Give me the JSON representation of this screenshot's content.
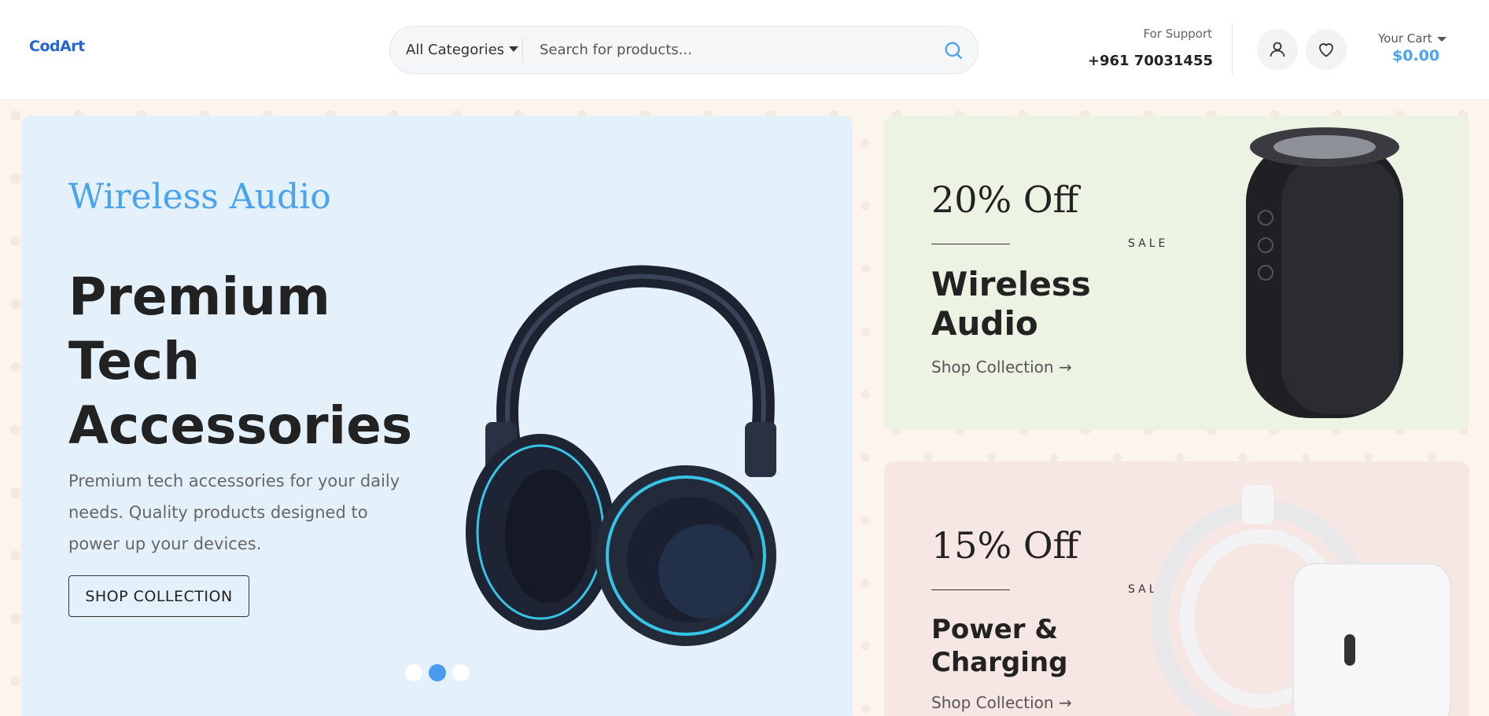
{
  "header": {
    "logo": "CodArt",
    "category_select": "All Categories",
    "search_placeholder": "Search for products...",
    "support_label": "For Support",
    "support_phone": "+961 70031455",
    "cart_label": "Your Cart",
    "cart_total": "$0.00"
  },
  "hero": {
    "subtitle": "Wireless Audio",
    "title": "Premium Tech Accessories",
    "description": "Premium tech accessories for your daily needs. Quality products designed to power up your devices.",
    "button_label": "SHOP COLLECTION",
    "active_slide": 2,
    "slide_count": 3
  },
  "promos": [
    {
      "discount": "20% Off",
      "sale_label": "SALE",
      "title": "Wireless Audio",
      "link": "Shop Collection →"
    },
    {
      "discount": "15% Off",
      "sale_label": "SALE",
      "title": "Power & Charging",
      "link": "Shop Collection →"
    }
  ],
  "colors": {
    "accent": "#4aa3f0",
    "hero_bg": "#e4f1fa",
    "promo1_bg": "#edf3e3",
    "promo2_bg": "#f7e7e4"
  }
}
